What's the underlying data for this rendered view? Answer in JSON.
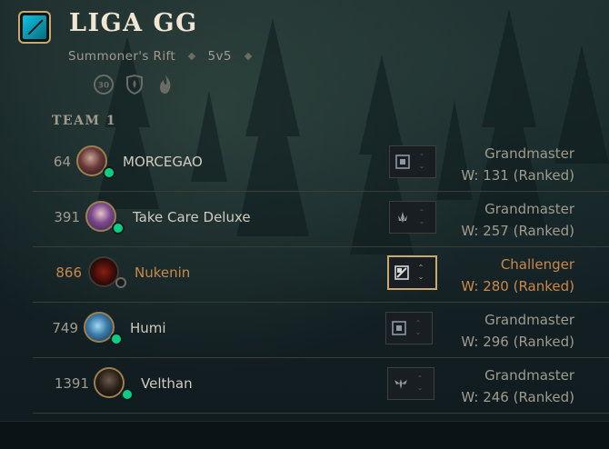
{
  "header": {
    "title": "LIGA GG",
    "map": "Summoner's Rift",
    "mode": "5v5",
    "icons": [
      "timer-30-icon",
      "shield-flame-icon",
      "flame-icon"
    ],
    "timer_label": "30"
  },
  "team": {
    "label": "TEAM 1",
    "players": [
      {
        "level": "64",
        "name": "MORCEGAO",
        "online": true,
        "rank": "Grandmaster",
        "wins": "W: 131 (Ranked)",
        "role_icon": "square-rune-icon",
        "selected": false
      },
      {
        "level": "391",
        "name": "Take Care Deluxe",
        "online": true,
        "rank": "Grandmaster",
        "wins": "W: 257 (Ranked)",
        "role_icon": "leaf-rune-icon",
        "selected": false
      },
      {
        "level": "866",
        "name": "Nukenin",
        "online": false,
        "rank": "Challenger",
        "wins": "W: 280 (Ranked)",
        "role_icon": "slash-square-rune-icon",
        "selected": true
      },
      {
        "level": "749",
        "name": "Humi",
        "online": true,
        "rank": "Grandmaster",
        "wins": "W: 296 (Ranked)",
        "role_icon": "square-rune-icon",
        "selected": false
      },
      {
        "level": "1391",
        "name": "Velthan",
        "online": true,
        "rank": "Grandmaster",
        "wins": "W: 246 (Ranked)",
        "role_icon": "wings-rune-icon",
        "selected": false
      }
    ]
  },
  "colors": {
    "gold": "#c8aa6e",
    "highlight": "#c8894a",
    "online": "#0acf83",
    "text": "#a09b8c"
  }
}
